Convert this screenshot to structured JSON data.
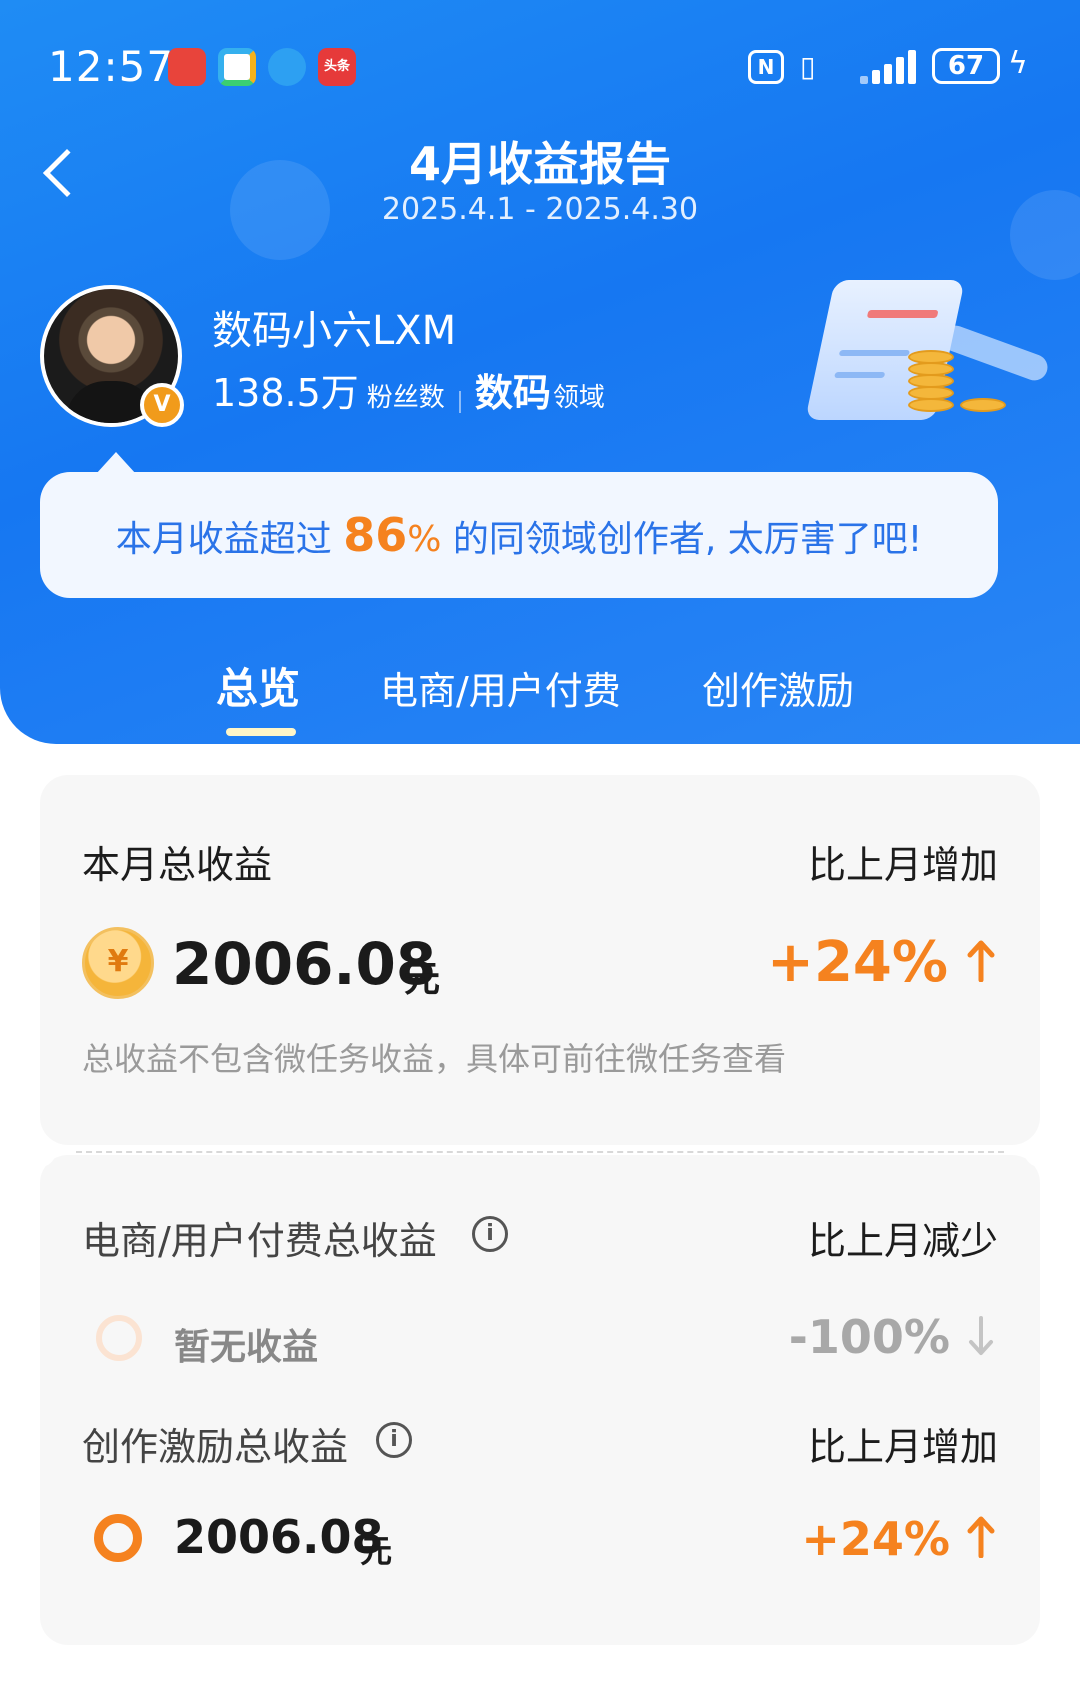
{
  "status_bar": {
    "time": "12:57",
    "notif_icons": [
      "missed-call-icon",
      "app-store-icon",
      "message-icon",
      "toutiao-icon"
    ],
    "toutiao_label": "头条",
    "nfc_label": "N",
    "battery": "67"
  },
  "header": {
    "title": "4月收益报告",
    "date_range": "2025.4.1 - 2025.4.30"
  },
  "profile": {
    "name": "数码小六LXM",
    "fans_count": "138.5万",
    "fans_label": "粉丝数",
    "domain_value": "数码",
    "domain_label": "领域",
    "badge": "V"
  },
  "bubble": {
    "text_before": "本月收益超过 ",
    "percent": "86",
    "percent_sign": "%",
    "text_after": " 的同领域创作者, 太厉害了吧!"
  },
  "tabs": [
    {
      "label": "总览",
      "active": true
    },
    {
      "label": "电商/用户付费",
      "active": false
    },
    {
      "label": "创作激励",
      "active": false
    }
  ],
  "summary": {
    "total_label": "本月总收益",
    "compare_label": "比上月增加",
    "coin_symbol": "¥",
    "amount": "2006.08",
    "unit": "元",
    "delta": "+24%",
    "note": "总收益不包含微任务收益，具体可前往微任务查看"
  },
  "ecommerce": {
    "label": "电商/用户付费总收益",
    "compare_label": "比上月减少",
    "empty_text": "暂无收益",
    "delta": "-100%"
  },
  "incentive": {
    "label": "创作激励总收益",
    "compare_label": "比上月增加",
    "amount": "2006.08",
    "unit": "元",
    "delta": "+24%"
  },
  "info_symbol": "i",
  "colors": {
    "header_blue": "#1677f2",
    "accent_orange": "#f5821f",
    "bubble_text": "#2a73e8"
  }
}
